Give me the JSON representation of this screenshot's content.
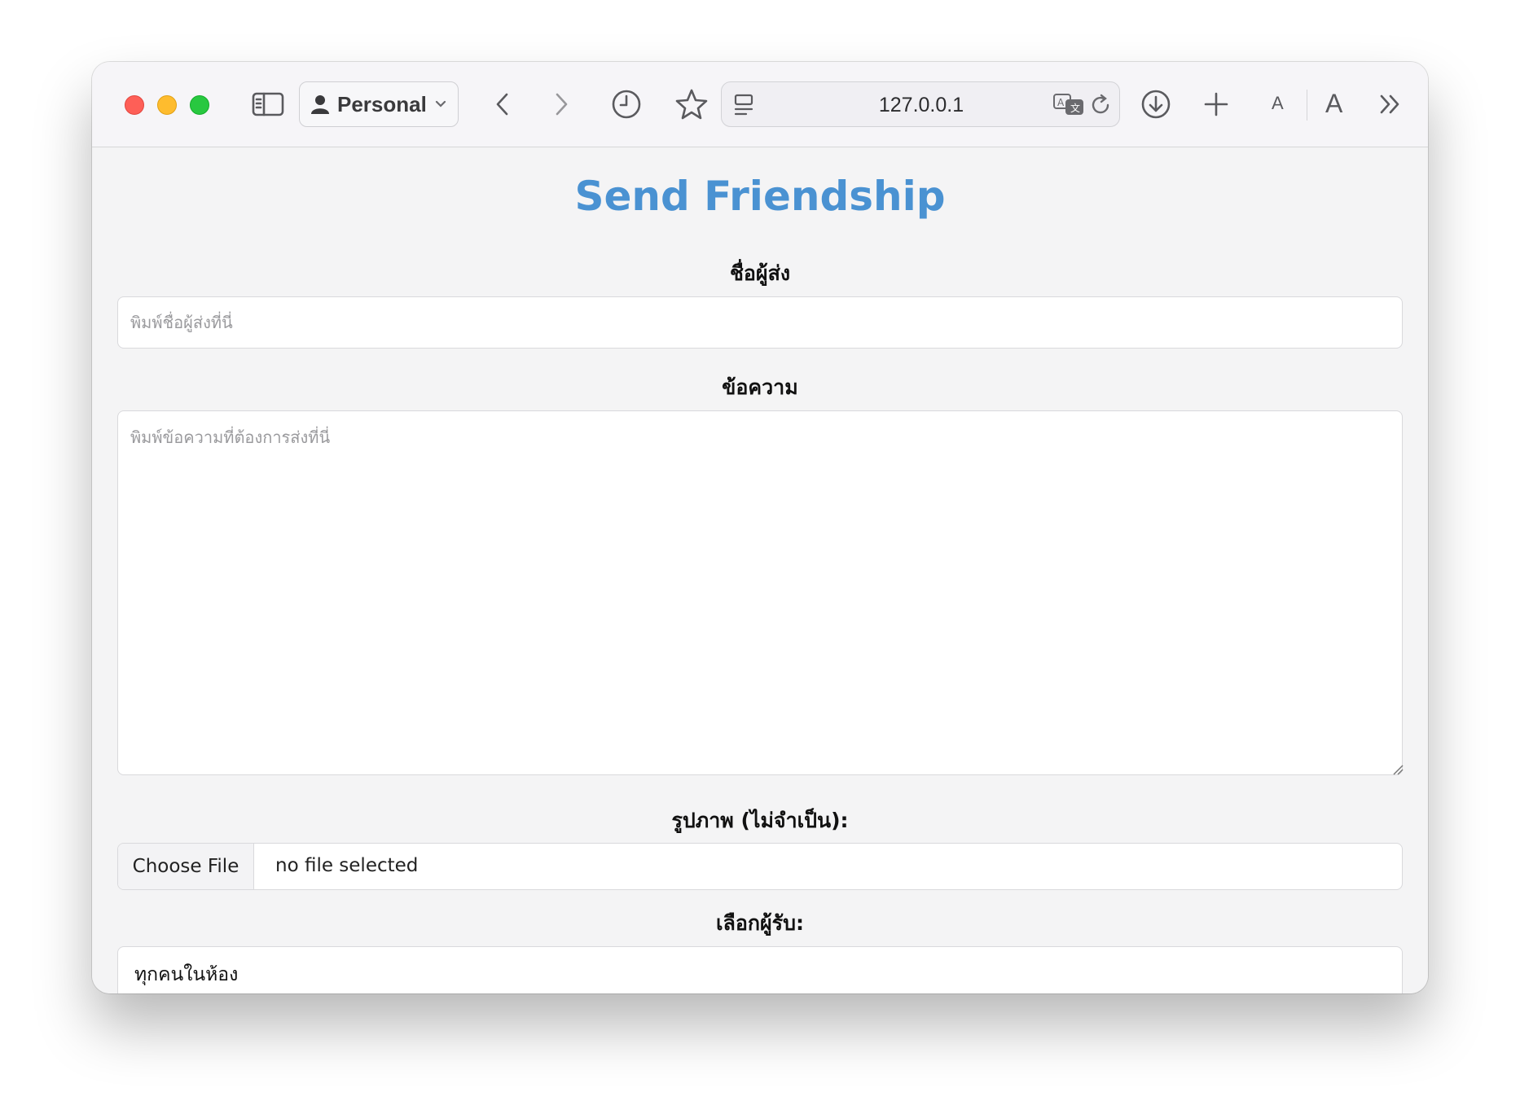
{
  "browser": {
    "profile_label": "Personal",
    "url": "127.0.0.1",
    "font_small_label": "A",
    "font_large_label": "A"
  },
  "page": {
    "title": "Send Friendship",
    "sender": {
      "label": "ชื่อผู้ส่ง",
      "placeholder": "พิมพ์ชื่อผู้ส่งที่นี่",
      "value": ""
    },
    "message": {
      "label": "ข้อความ",
      "placeholder": "พิมพ์ข้อความที่ต้องการส่งที่นี่",
      "value": ""
    },
    "image": {
      "label": "รูปภาพ (ไม่จำเป็น):",
      "button_label": "Choose File",
      "status": "no file selected"
    },
    "recipient": {
      "label": "เลือกผู้รับ:",
      "selected": "ทุกคนในห้อง"
    }
  }
}
